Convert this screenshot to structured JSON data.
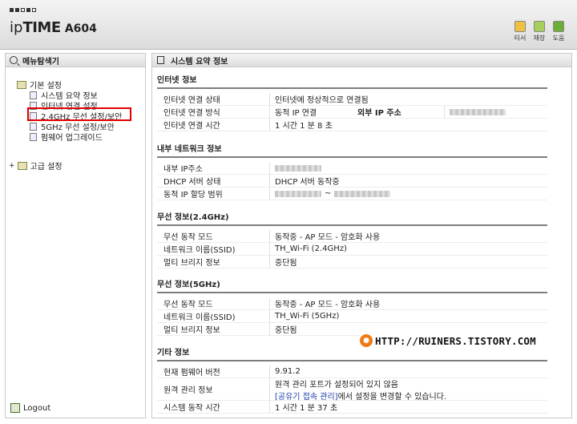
{
  "header": {
    "brand_prefix": "ip",
    "brand_main": "TIME",
    "model": "A604",
    "buttons": [
      {
        "label": "티서",
        "icon": "page-icon",
        "color": "#e0a419"
      },
      {
        "label": "재장",
        "icon": "save-icon",
        "color": "#7ab02e"
      },
      {
        "label": "도움",
        "icon": "help-icon",
        "color": "#5a9e2f"
      }
    ]
  },
  "sidebar": {
    "title": "메뉴탐색기",
    "items": [
      {
        "label": "기본 설정"
      },
      {
        "label": "시스템 요약 정보"
      },
      {
        "label": "인터넷 연결 설정"
      },
      {
        "label": "2.4GHz 무선 설정/보안"
      },
      {
        "label": "5GHz 무선 설정/보안"
      },
      {
        "label": "펌웨어 업그레이드"
      },
      {
        "label": "고급 설정"
      }
    ],
    "plus": "+",
    "logout": "Logout"
  },
  "main": {
    "title": "시스템 요약 정보",
    "internet": {
      "title": "인터넷 정보",
      "status_label": "인터넷 연결 상태",
      "status_value": "인터넷에 정상적으로 연결됨",
      "method_label": "인터넷 연결 방식",
      "method_value": "동적 IP 연결",
      "external_ip_label": "외부 IP 주소",
      "time_label": "인터넷 연결 시간",
      "time_value": "1 시간 1 분 8 초"
    },
    "lan": {
      "title": "내부 네트워크 정보",
      "ip_label": "내부 IP주소",
      "dhcp_label": "DHCP 서버 상태",
      "dhcp_value": "DHCP 서버 동작중",
      "range_label": "동적 IP 할당 범위",
      "range_sep": "~"
    },
    "wifi24": {
      "title": "무선 정보(2.4GHz)",
      "mode_label": "무선 동작 모드",
      "mode_value": "동작중 - AP 모드 - 암호화 사용",
      "ssid_label": "네트워크 이름(SSID)",
      "ssid_value": "TH_Wi-Fi (2.4GHz)",
      "bridge_label": "멀티 브리지 정보",
      "bridge_value": "중단됨"
    },
    "wifi5": {
      "title": "무선 정보(5GHz)",
      "mode_label": "무선 동작 모드",
      "mode_value": "동작중 - AP 모드 - 암호화 사용",
      "ssid_label": "네트워크 이름(SSID)",
      "ssid_value": "TH_Wi-Fi (5GHz)",
      "bridge_label": "멀티 브리지 정보",
      "bridge_value": "중단됨"
    },
    "etc": {
      "title": "기타 정보",
      "fw_label": "현재 펌웨어 버전",
      "fw_value": "9.91.2",
      "remote_label": "원격 관리 정보",
      "remote_line1": "원격 관리 포트가 설정되어 있지 않음",
      "remote_link": "[공유기 접속 관리]",
      "remote_line2": "에서 설정을 변경할 수 있습니다.",
      "uptime_label": "시스템 동작 시간",
      "uptime_value": "1 시간 1 분 37 초"
    }
  },
  "watermark": "HTTP://RUINERS.TISTORY.COM"
}
